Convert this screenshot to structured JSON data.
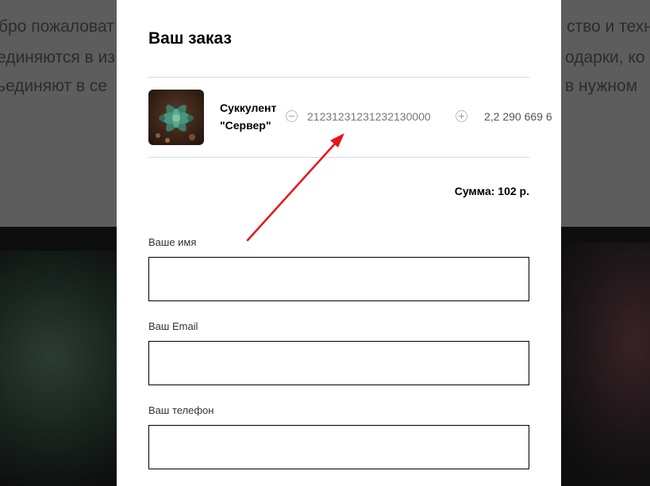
{
  "background": {
    "line1_left": "бро пожаловат",
    "line1_right": "ство и техн",
    "line2_left": "единяются в из",
    "line2_right": "одарки, ко",
    "line3_left": "ьединяют в се",
    "line3_right": "в нужном"
  },
  "modal": {
    "title": "Ваш заказ",
    "product": {
      "name": "Суккулент \"Сервер\"",
      "quantity": "21231231231232130000",
      "minus_icon": "minus-circle-icon",
      "plus_icon": "plus-circle-icon",
      "price": "2,2 290 669 6"
    },
    "sum": "Сумма: 102 р.",
    "fields": {
      "name_label": "Ваше имя",
      "email_label": "Ваш Email",
      "phone_label": "Ваш телефон"
    }
  },
  "annotation": {
    "arrow_color": "#e8141b"
  }
}
